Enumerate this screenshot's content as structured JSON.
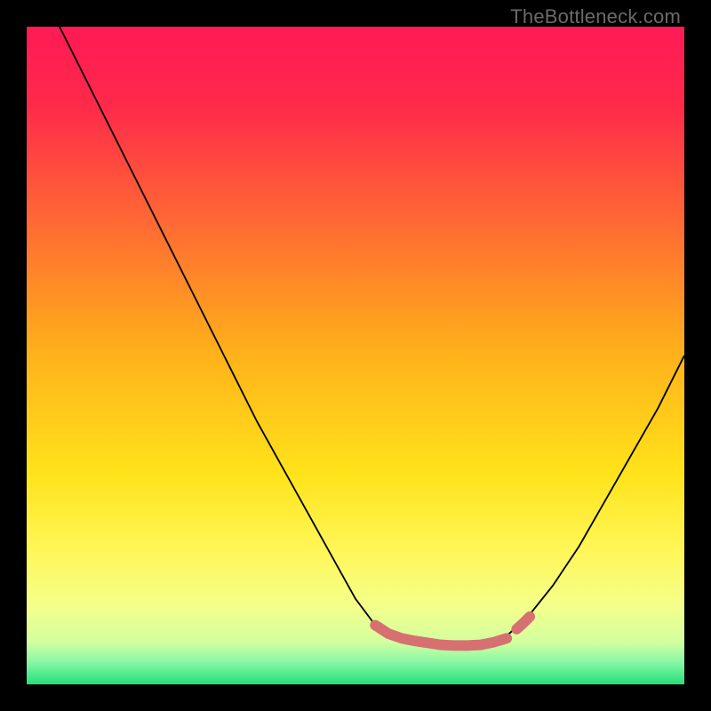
{
  "attribution": "TheBottleneck.com",
  "colors": {
    "frame": "#000000",
    "gradient_stops": [
      {
        "offset": 0.0,
        "color": "#ff1a55"
      },
      {
        "offset": 0.12,
        "color": "#ff2a4a"
      },
      {
        "offset": 0.3,
        "color": "#ff6a33"
      },
      {
        "offset": 0.5,
        "color": "#ffb21a"
      },
      {
        "offset": 0.68,
        "color": "#ffe31a"
      },
      {
        "offset": 0.8,
        "color": "#fff75a"
      },
      {
        "offset": 0.88,
        "color": "#f4ff8a"
      },
      {
        "offset": 0.935,
        "color": "#d4ffa0"
      },
      {
        "offset": 0.965,
        "color": "#8cf7a6"
      },
      {
        "offset": 1.0,
        "color": "#22e07a"
      }
    ],
    "curve_stroke": "#000000",
    "highlight_stroke": "#d77070"
  },
  "chart_data": {
    "type": "line",
    "title": "",
    "xlabel": "",
    "ylabel": "",
    "xlim": [
      0,
      100
    ],
    "ylim": [
      0,
      100
    ],
    "categories_note": "No axis ticks or labels are rendered in the image; values are normalized to a 0–100 plot space read from the figure geometry.",
    "series": [
      {
        "name": "black-curve-left",
        "x": [
          5,
          10,
          15,
          20,
          25,
          30,
          35,
          40,
          45,
          50,
          53,
          55,
          58,
          60
        ],
        "y": [
          100,
          90,
          80,
          70,
          60,
          50,
          40,
          31,
          22,
          13,
          9,
          7.5,
          6.7,
          6.5
        ]
      },
      {
        "name": "black-curve-bottom-flat",
        "x": [
          60,
          62,
          64,
          66,
          68,
          70,
          72,
          73
        ],
        "y": [
          6.5,
          6.1,
          5.9,
          5.8,
          5.9,
          6.2,
          6.8,
          7.4
        ]
      },
      {
        "name": "black-curve-right",
        "x": [
          73,
          76,
          80,
          84,
          88,
          92,
          96,
          100
        ],
        "y": [
          7.4,
          10,
          15,
          21,
          28,
          35,
          42,
          50
        ]
      },
      {
        "name": "pink-highlight-left-segment",
        "x": [
          53,
          55,
          57,
          59,
          61,
          63,
          65,
          67,
          69,
          71,
          73
        ],
        "y": [
          9.0,
          7.7,
          7.0,
          6.6,
          6.3,
          6.0,
          5.9,
          5.9,
          6.0,
          6.4,
          7.0
        ]
      },
      {
        "name": "pink-highlight-right-segment",
        "x": [
          74.5,
          75.5,
          76.5
        ],
        "y": [
          8.4,
          9.3,
          10.3
        ]
      }
    ]
  }
}
